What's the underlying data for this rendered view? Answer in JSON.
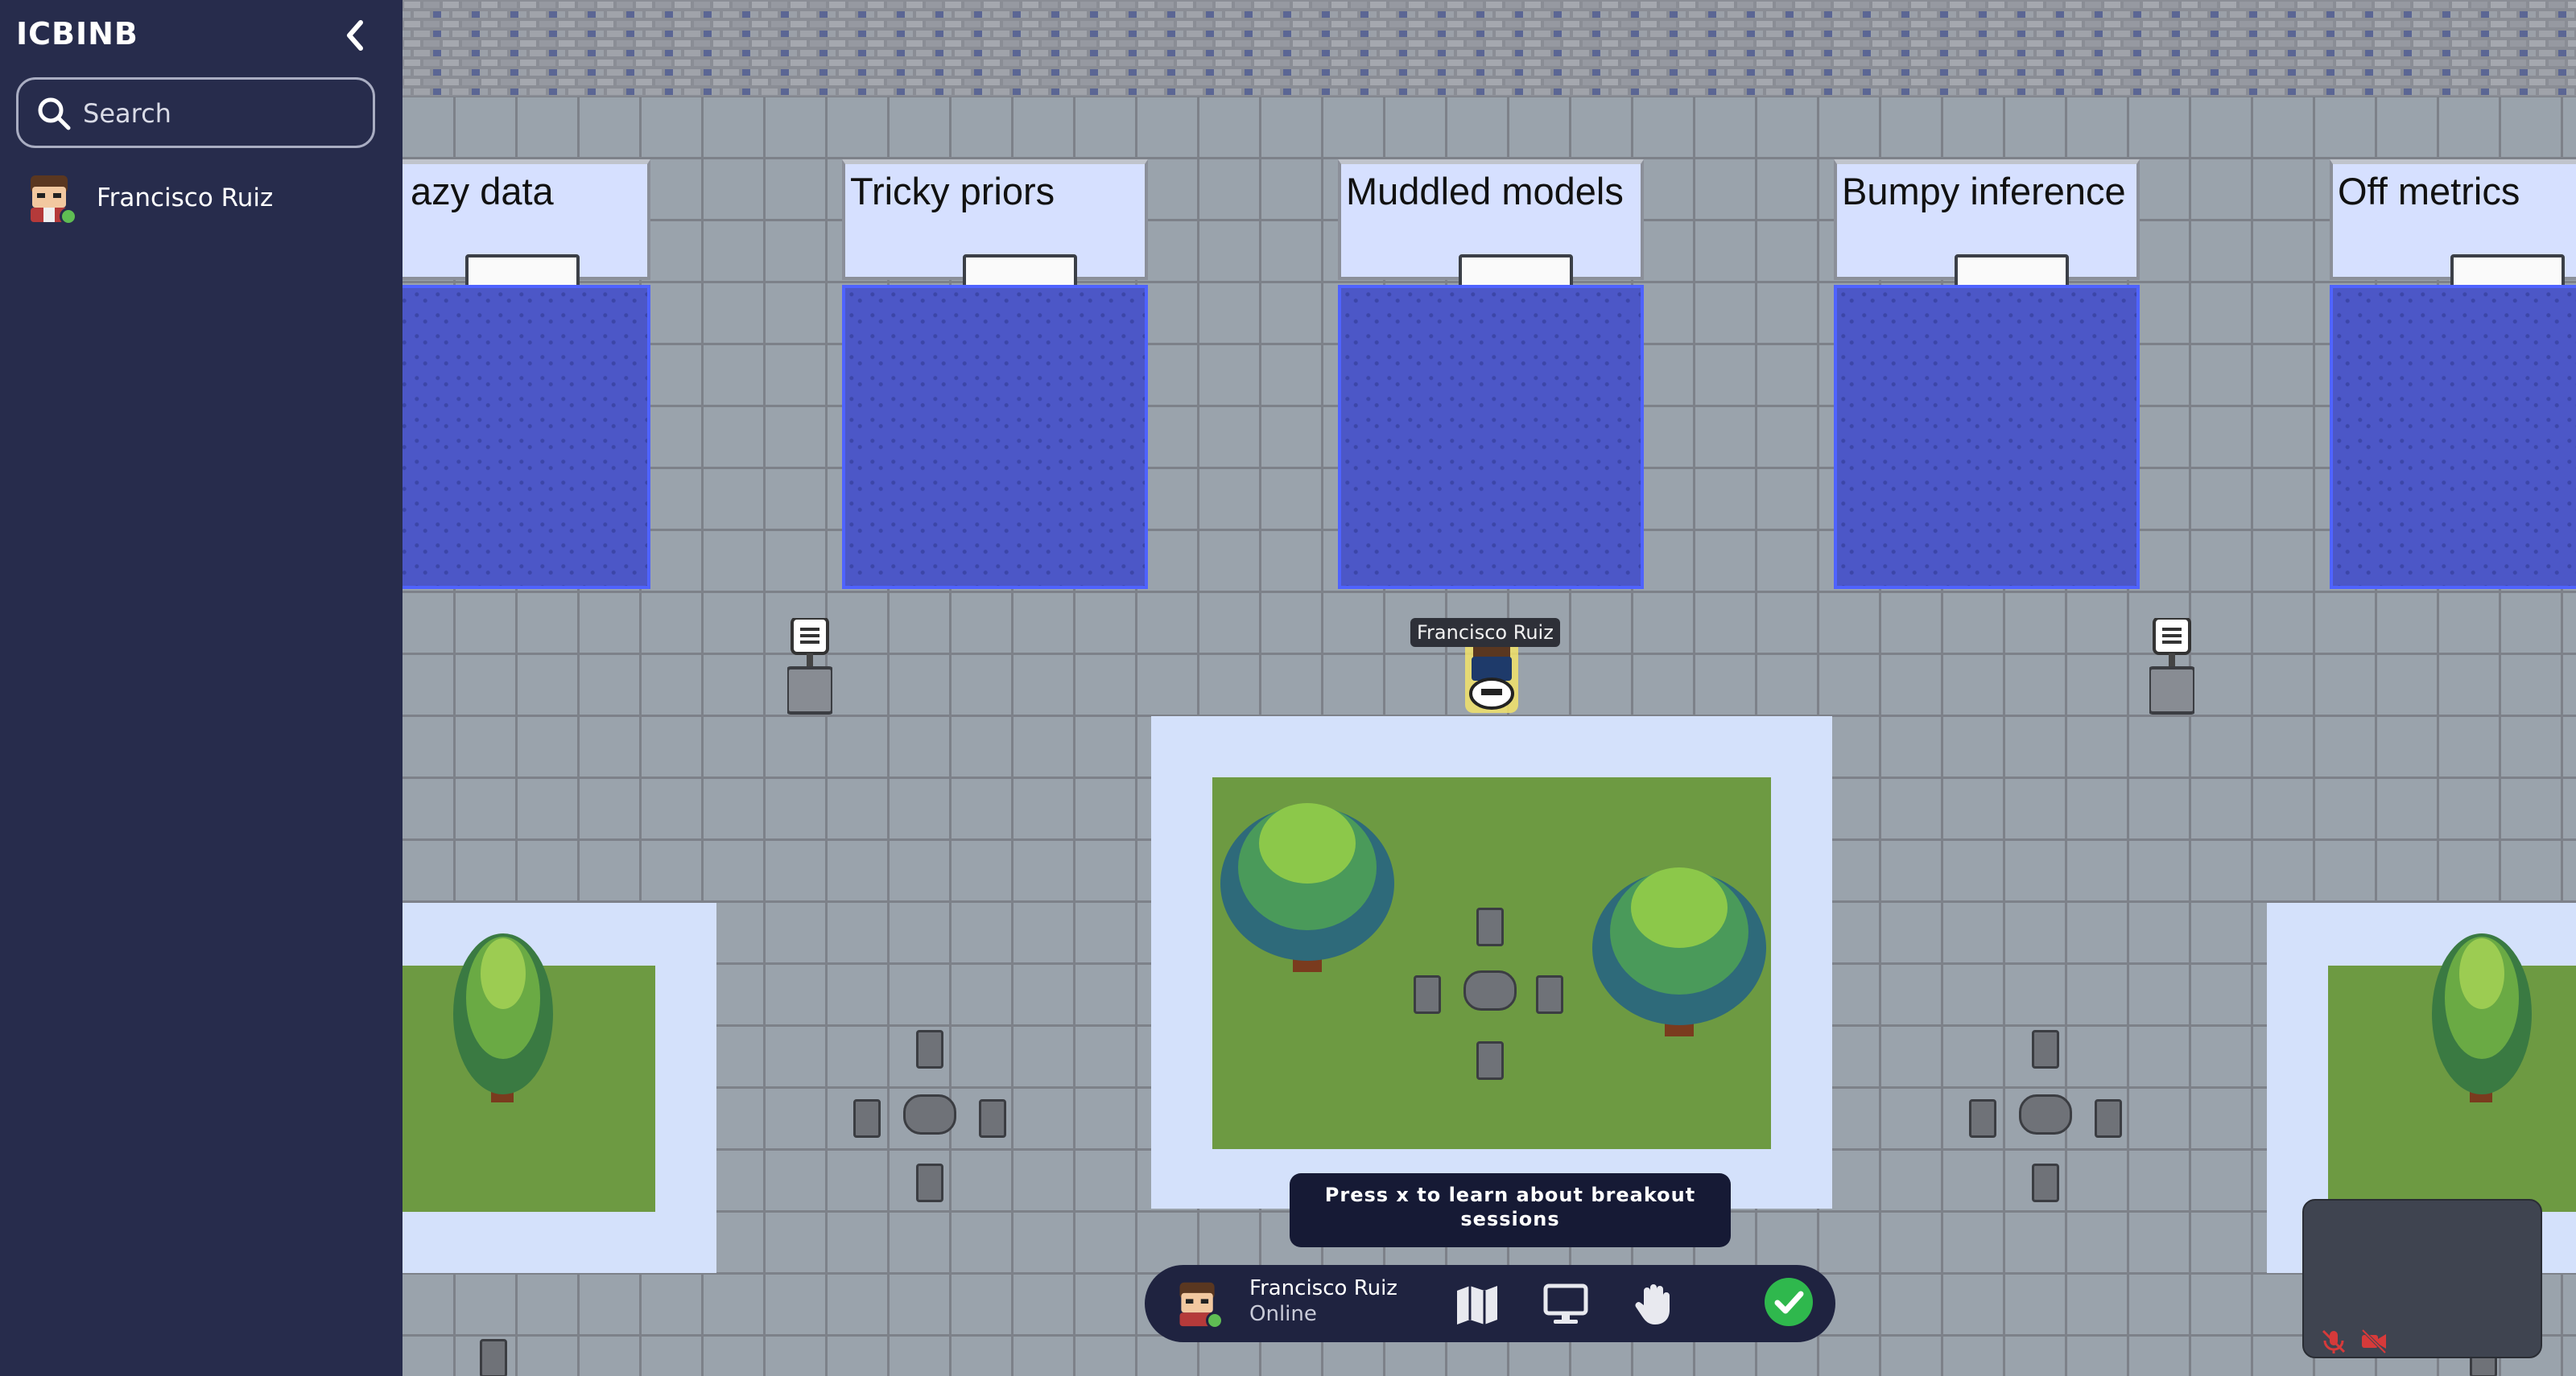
{
  "sidebar": {
    "title": "ICBINB",
    "search_placeholder": "Search",
    "users": [
      {
        "name": "Francisco Ruiz",
        "status_color": "#5fbd53"
      }
    ]
  },
  "booths": [
    {
      "label": "azy data"
    },
    {
      "label": "Tricky priors"
    },
    {
      "label": "Muddled models"
    },
    {
      "label": "Bumpy inference"
    },
    {
      "label": "Off metrics"
    }
  ],
  "player": {
    "name": "Francisco Ruiz"
  },
  "hint": {
    "text": "Press x to learn about breakout sessions"
  },
  "bottom_bar": {
    "name": "Francisco Ruiz",
    "status": "Online"
  },
  "colors": {
    "sidebar_bg": "#272c4c",
    "carpet": "#4c57c7",
    "online": "#5fbd53",
    "check": "#2fb84d"
  }
}
